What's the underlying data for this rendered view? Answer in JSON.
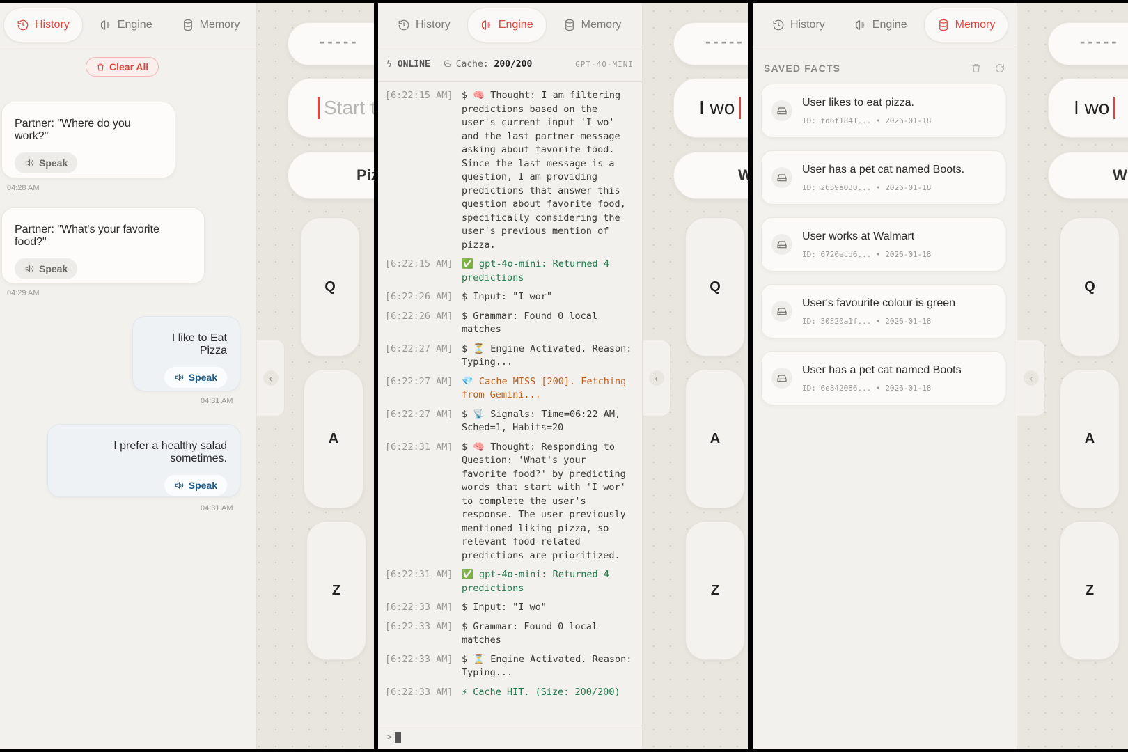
{
  "tabs": {
    "history": "History",
    "engine": "Engine",
    "memory": "Memory"
  },
  "editor": {
    "placeholder": "Start ty",
    "typed": "I wo",
    "dash": "-----",
    "suggest1": "Piz",
    "suggest2": "W",
    "keys": [
      "Q",
      "A",
      "Z"
    ]
  },
  "history": {
    "clear_label": "Clear All",
    "speak_label": "Speak",
    "messages": [
      {
        "text": "Partner: \"Where do you work?\"",
        "time": "04:28 AM"
      },
      {
        "text": "Partner: \"What's your favorite food?\"",
        "time": "04:29 AM"
      },
      {
        "text": "I like to Eat Pizza",
        "time": "04:31 AM"
      },
      {
        "text": "I prefer a healthy salad sometimes.",
        "time": "04:31 AM"
      }
    ]
  },
  "engine": {
    "status": "ONLINE",
    "cache_label": "Cache:",
    "cache_value": "200/200",
    "model": "GPT-4O-MINI",
    "prompt": ">",
    "log": [
      {
        "time": "[6:22:15 AM]",
        "msg": "$ 🧠 Thought: I am filtering predictions based on the user's current input 'I wo' and the last partner message asking about favorite food. Since the last message is a question, I am providing predictions that answer this question about favorite food, specifically considering the user's previous mention of pizza."
      },
      {
        "time": "[6:22:15 AM]",
        "msg": "✅ gpt-4o-mini: Returned 4 predictions"
      },
      {
        "time": "[6:22:26 AM]",
        "msg": "$ Input: \"I wor\""
      },
      {
        "time": "[6:22:26 AM]",
        "msg": "$ Grammar: Found 0 local matches"
      },
      {
        "time": "[6:22:27 AM]",
        "msg": "$ ⏳ Engine Activated. Reason: Typing..."
      },
      {
        "time": "[6:22:27 AM]",
        "msg": "💎 Cache MISS [200]. Fetching from Gemini..."
      },
      {
        "time": "[6:22:27 AM]",
        "msg": "$ 📡 Signals: Time=06:22 AM, Sched=1, Habits=20"
      },
      {
        "time": "[6:22:31 AM]",
        "msg": "$ 🧠 Thought: Responding to Question: 'What's your favorite food?' by predicting words that start with 'I wor' to complete the user's response. The user previously mentioned liking pizza, so relevant food-related predictions are prioritized."
      },
      {
        "time": "[6:22:31 AM]",
        "msg": "✅ gpt-4o-mini: Returned 4 predictions"
      },
      {
        "time": "[6:22:33 AM]",
        "msg": "$ Input: \"I wo\""
      },
      {
        "time": "[6:22:33 AM]",
        "msg": "$ Grammar: Found 0 local matches"
      },
      {
        "time": "[6:22:33 AM]",
        "msg": "$ ⏳ Engine Activated. Reason: Typing..."
      },
      {
        "time": "[6:22:33 AM]",
        "msg": "⚡ Cache HIT. (Size: 200/200)"
      }
    ]
  },
  "memory": {
    "heading": "SAVED FACTS",
    "facts": [
      {
        "text": "User likes to eat pizza.",
        "meta": "ID: fd6f1841... • 2026-01-18"
      },
      {
        "text": "User has a pet cat named Boots.",
        "meta": "ID: 2659a030... • 2026-01-18"
      },
      {
        "text": "User works at Walmart",
        "meta": "ID: 6720ecd6... • 2026-01-18"
      },
      {
        "text": "User's favourite colour is green",
        "meta": "ID: 30320a1f... • 2026-01-18"
      },
      {
        "text": "User has a pet cat named Boots",
        "meta": "ID: 6e842086... • 2026-01-18"
      }
    ]
  }
}
